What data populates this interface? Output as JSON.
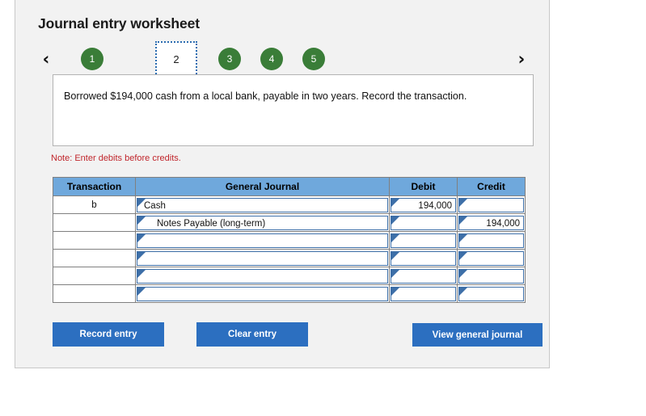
{
  "worksheet": {
    "title": "Journal entry worksheet",
    "note": "Note: Enter debits before credits.",
    "description": "Borrowed $194,000 cash from a local bank, payable in two years. Record the transaction."
  },
  "pager": {
    "prev_icon": "chevron-left-icon",
    "next_icon": "chevron-right-icon",
    "prev_glyph": "‹",
    "next_glyph": "›",
    "steps": [
      {
        "label": "1",
        "state": "complete"
      },
      {
        "label": "2",
        "state": "current"
      },
      {
        "label": "3",
        "state": "complete"
      },
      {
        "label": "4",
        "state": "complete"
      },
      {
        "label": "5",
        "state": "complete"
      }
    ],
    "complete_color": "#3a7d38",
    "current_border_color": "#2b6cb0"
  },
  "table": {
    "headers": [
      "Transaction",
      "General Journal",
      "Debit",
      "Credit"
    ],
    "header_bg": "#6fa8dc",
    "rows": [
      {
        "transaction": "b",
        "account": "Cash",
        "indent": false,
        "debit": "194,000",
        "credit": ""
      },
      {
        "transaction": "",
        "account": "Notes Payable (long-term)",
        "indent": true,
        "debit": "",
        "credit": "194,000"
      },
      {
        "transaction": "",
        "account": "",
        "indent": false,
        "debit": "",
        "credit": ""
      },
      {
        "transaction": "",
        "account": "",
        "indent": false,
        "debit": "",
        "credit": ""
      },
      {
        "transaction": "",
        "account": "",
        "indent": false,
        "debit": "",
        "credit": ""
      },
      {
        "transaction": "",
        "account": "",
        "indent": false,
        "debit": "",
        "credit": ""
      }
    ]
  },
  "buttons": {
    "record": "Record entry",
    "clear": "Clear entry",
    "view": "View general journal",
    "color": "#2c6fc0"
  }
}
